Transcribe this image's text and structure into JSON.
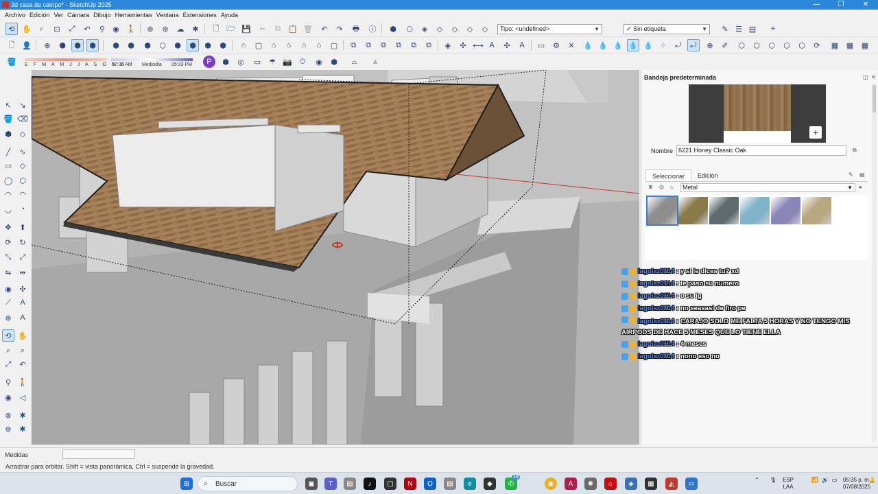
{
  "window": {
    "title": "3d casa de campo* - SketchUp 2025"
  },
  "menu": [
    "Archivo",
    "Edición",
    "Ver",
    "Cámara",
    "Dibujo",
    "Herramientas",
    "Ventana",
    "Extensiones",
    "Ayuda"
  ],
  "toolbar": {
    "tag_type_label": "Tipo: <undefined>",
    "tag_label": "Sin etiqueta",
    "tag_check": "✓"
  },
  "shadow": {
    "months": "E F M A M J J A S O N D",
    "sunrise": "07:35 AM",
    "midday": "Mediodía",
    "sunset": "05:33 PM"
  },
  "tray_panel": {
    "title": "Bandeja predeterminada",
    "name_label": "Nombre",
    "material_name": "6221 Honey Classic Oak",
    "tabs": [
      "Seleccionar",
      "Edición"
    ],
    "library": "Metal",
    "swatches": [
      "#8e8e8e",
      "#8a7a4a",
      "#5e6a6e",
      "#7fb3c9",
      "#8a86b8",
      "#b8a880"
    ]
  },
  "chat": [
    {
      "user": "lagolaz0114",
      "msg": ": y si le dices tu? xd"
    },
    {
      "user": "lagolaz0114",
      "msg": ": te paso su numero"
    },
    {
      "user": "lagolaz0114",
      "msg": ": o su ig"
    },
    {
      "user": "lagolaz0114",
      "msg": ": no seasasi de firo pe"
    },
    {
      "user": "lagolaz0114",
      "msg": ": CARAJO SOLO ME FALTA 5 HORAS Y NO TENGO MIS AIRPODS DE HACE 5 MESES QUE LO TIENE ELLA"
    },
    {
      "user": "lagolaz0114",
      "msg": ": 4 meses"
    },
    {
      "user": "lagolaz0114",
      "msg": ": nono eso no"
    }
  ],
  "status": {
    "measure_label": "Medidas",
    "hint": "Arrastrar para orbitar. Shift = vista panorámica, Ctrl = suspende la gravedad."
  },
  "taskbar": {
    "search_placeholder": "Buscar",
    "whatsapp_badge": "28",
    "lang": "ESP",
    "layout": "LAA",
    "time": "05:35 p. m.",
    "date": "07/08/2025"
  }
}
